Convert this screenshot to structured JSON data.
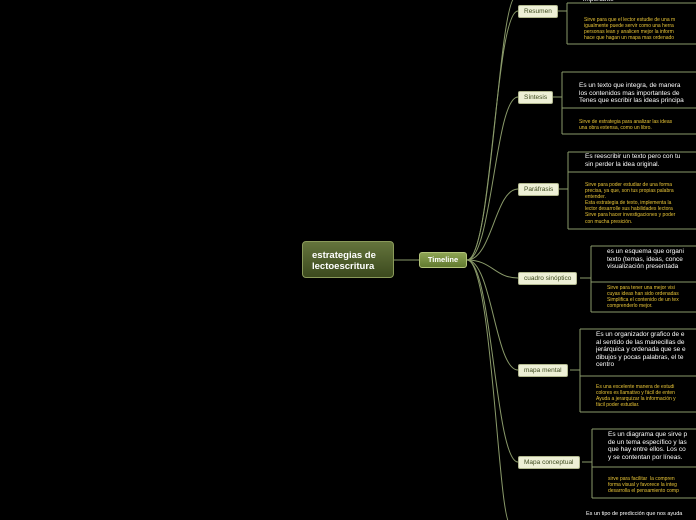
{
  "root": {
    "line1": "estrategias de",
    "line2": "lectoescritura"
  },
  "hub": {
    "label": "Timeline"
  },
  "colors": {
    "background": "#000000",
    "link": "#8a9a6a",
    "note_text": "#e8c436",
    "topic_fill": "#eef0d6"
  },
  "top_fragment": "importante",
  "bottom_fragment": "Es un tipo de predicción que nos ayuda",
  "topics": [
    {
      "label": "Resumen",
      "description": "",
      "note": "Sirve para que el lector estudie de una m\nigualmente puede servir como una herra\npersonas lean y analicen mejor la inform\nhace que hagan un mapa mas ordenado"
    },
    {
      "label": "Síntesis",
      "description": "Es un texto que integra, de manera\nlos contenidos mas importantes de\nTenes que escribir las ideas principa",
      "note": "Sirve de estrategia para analizar las ideas\nuna obra extensa, como un libro."
    },
    {
      "label": "Paráfrasis",
      "description": "Es reescribir un texto pero con tu\nsin perder la idea original.",
      "note": "Sirve para poder estudiar de una forma\nprecisa, ya que, son tus propias palabra\nentender.\nEsta estrategia de texto, implementa la\nlector desarrolle sus habilidades lectora\nSirve para hacer investigaciones y poder\ncon mucha presición."
    },
    {
      "label": "cuadro sinóptico",
      "description": "es un esquema que organi\ntexto (temas, ideas, conce\nvisualización presentada",
      "note": "Sirve para tener una mejor visi\ncuyas ideas han sido ordenadas\nSimplifica el contenido de un tex\ncomprenderlo mejor."
    },
    {
      "label": "mapa mental",
      "description": "Es un organizador grafico de e\nal sentido de las manecillas de\njerárquica y ordenada que se e\ndibujos y pocas palabras, el te\ncentro",
      "note": "Es una excelente manera de estudi\ncolores es llamativo y fácil de enten\nAyuda a jerarquizar la información y\nfácil poder estudiar."
    },
    {
      "label": "Mapa conceptual",
      "description": "Es un diagrama que sirve p\nde un tema específico y las\nque hay entre ellos. Los co\ny se contentan por líneas.",
      "note": "sirve para facilitar  la compren\nforma visual y favorece la integ\ndesarrolla el pensamiento comp"
    }
  ]
}
